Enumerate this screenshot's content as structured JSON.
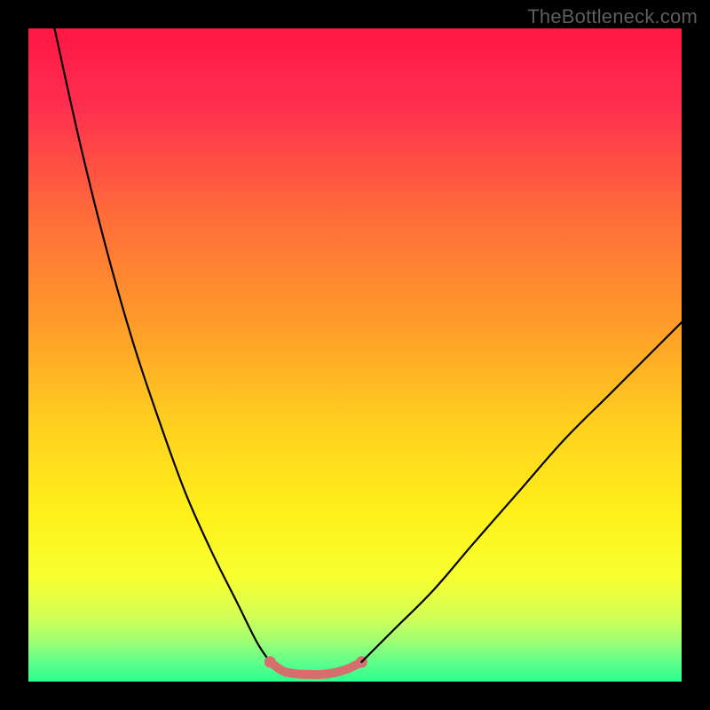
{
  "watermark": "TheBottleneck.com",
  "chart_data": {
    "type": "line",
    "title": "",
    "xlabel": "",
    "ylabel": "",
    "xlim": [
      0,
      100
    ],
    "ylim": [
      0,
      100
    ],
    "grid": false,
    "legend": false,
    "series": [
      {
        "name": "left-curve",
        "x": [
          4,
          8,
          12,
          16,
          20,
          24,
          28,
          32,
          35,
          37
        ],
        "y": [
          100,
          82,
          66,
          52,
          40,
          29,
          20,
          12,
          6,
          3
        ],
        "color": "#000000"
      },
      {
        "name": "valley-floor",
        "x": [
          37,
          39,
          41,
          43,
          45,
          47,
          49,
          51
        ],
        "y": [
          3,
          1.6,
          1.2,
          1.1,
          1.1,
          1.4,
          2,
          3
        ],
        "color": "#d66e6e",
        "thick": true
      },
      {
        "name": "right-curve",
        "x": [
          51,
          56,
          62,
          68,
          75,
          82,
          89,
          96,
          100
        ],
        "y": [
          3,
          8,
          14,
          21,
          29,
          37,
          44,
          51,
          55
        ],
        "color": "#000000"
      }
    ],
    "background_gradient": {
      "stops": [
        {
          "pos": 0.0,
          "color": "#ff1744"
        },
        {
          "pos": 0.12,
          "color": "#ff2f4f"
        },
        {
          "pos": 0.28,
          "color": "#ff6a3a"
        },
        {
          "pos": 0.45,
          "color": "#ff9b2a"
        },
        {
          "pos": 0.6,
          "color": "#ffce1f"
        },
        {
          "pos": 0.74,
          "color": "#fff01a"
        },
        {
          "pos": 0.84,
          "color": "#f7ff30"
        },
        {
          "pos": 0.9,
          "color": "#d4ff55"
        },
        {
          "pos": 0.94,
          "color": "#9bff75"
        },
        {
          "pos": 0.97,
          "color": "#5fff8a"
        },
        {
          "pos": 1.0,
          "color": "#2aff8f"
        }
      ]
    }
  }
}
